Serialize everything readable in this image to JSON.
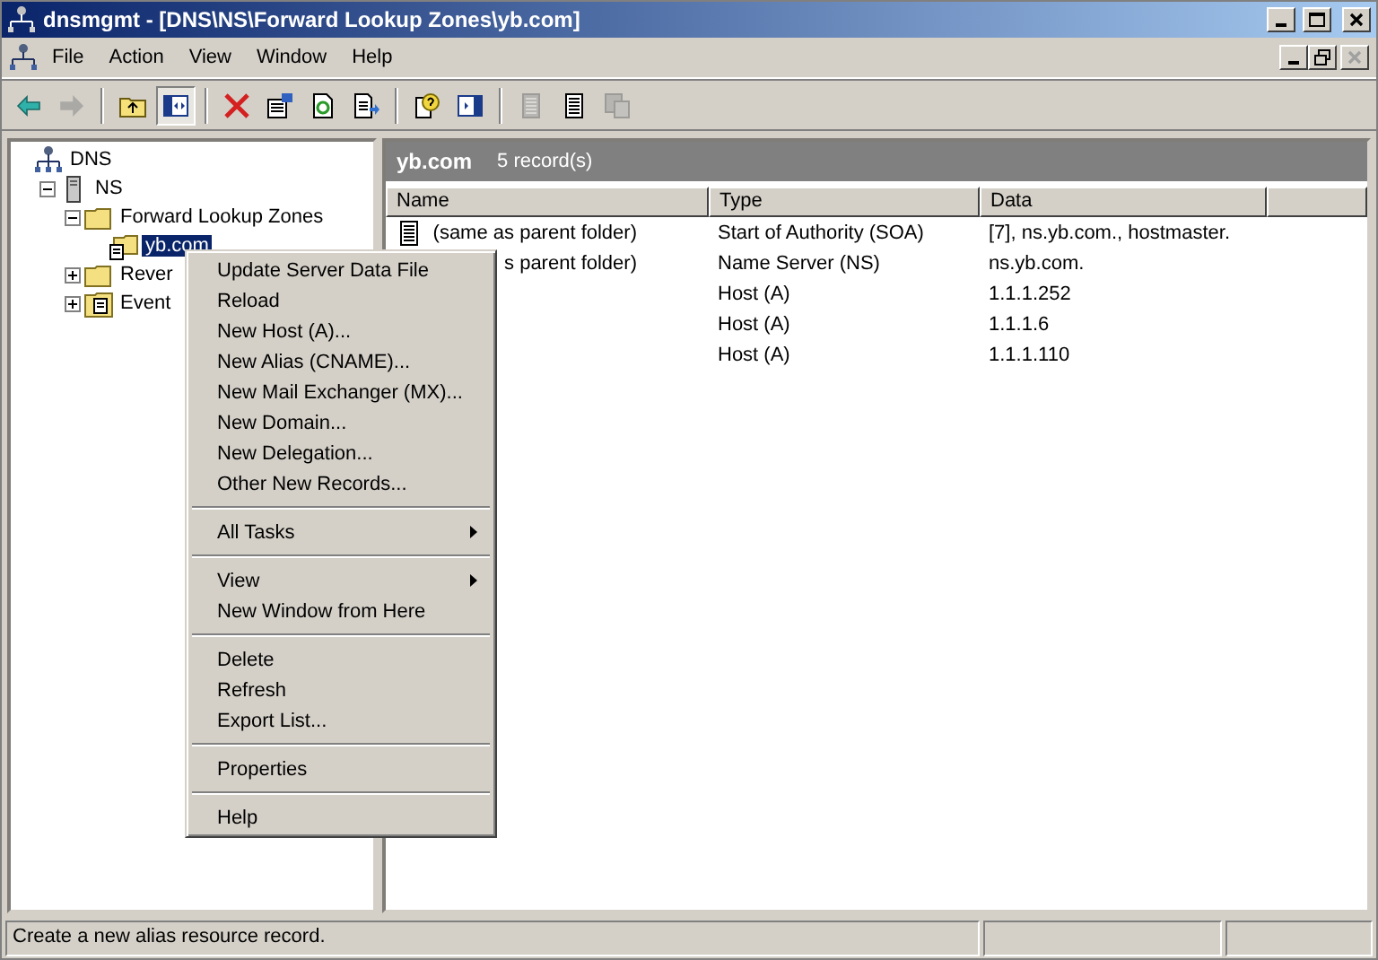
{
  "window": {
    "title": "dnsmgmt - [DNS\\NS\\Forward Lookup Zones\\yb.com]"
  },
  "menu_bar": [
    "File",
    "Action",
    "View",
    "Window",
    "Help"
  ],
  "toolbar": [
    {
      "kind": "back",
      "disabled": false
    },
    {
      "kind": "forward",
      "disabled": true
    },
    {
      "kind": "sep"
    },
    {
      "kind": "up",
      "disabled": false
    },
    {
      "kind": "tree",
      "disabled": false,
      "pressed": true
    },
    {
      "kind": "sep"
    },
    {
      "kind": "delete",
      "disabled": false
    },
    {
      "kind": "properties",
      "disabled": false
    },
    {
      "kind": "refresh",
      "disabled": false
    },
    {
      "kind": "export",
      "disabled": false
    },
    {
      "kind": "sep"
    },
    {
      "kind": "help",
      "disabled": false
    },
    {
      "kind": "pane",
      "disabled": false
    },
    {
      "kind": "sep"
    },
    {
      "kind": "doc",
      "disabled": true
    },
    {
      "kind": "doc",
      "disabled": false
    },
    {
      "kind": "copy",
      "disabled": true
    }
  ],
  "tree": [
    {
      "label": "DNS",
      "kind": "root",
      "selected": false,
      "children": [
        {
          "label": "NS",
          "kind": "server",
          "expanded": true,
          "selected": false,
          "children": [
            {
              "label": "Forward Lookup Zones",
              "kind": "folder",
              "expanded": true,
              "selected": false,
              "children": [
                {
                  "label": "yb.com",
                  "kind": "zone",
                  "selected": true
                }
              ]
            },
            {
              "label": "Rever",
              "kind": "folder",
              "expanded": false,
              "selected": false
            },
            {
              "label": "Event",
              "kind": "log",
              "expanded": false,
              "selected": false
            }
          ]
        }
      ]
    }
  ],
  "details": {
    "title": "yb.com",
    "count": "5 record(s)",
    "columns": [
      "Name",
      "Type",
      "Data"
    ],
    "rows": [
      {
        "name": "(same as parent folder)",
        "icon": true,
        "type": "Start of Authority (SOA)",
        "data": "[7], ns.yb.com., hostmaster."
      },
      {
        "name": "s parent folder)",
        "type": "Name Server (NS)",
        "data": "ns.yb.com."
      },
      {
        "type": "Host (A)",
        "data": "1.1.1.252"
      },
      {
        "type": "Host (A)",
        "data": "1.1.1.6"
      },
      {
        "type": "Host (A)",
        "data": "1.1.1.110"
      }
    ]
  },
  "context_menu": [
    [
      {
        "label": "Update Server Data File",
        "submenu": false
      },
      {
        "label": "Reload",
        "submenu": false
      },
      {
        "label": "New Host (A)...",
        "submenu": false
      },
      {
        "label": "New Alias (CNAME)...",
        "submenu": false
      },
      {
        "label": "New Mail Exchanger (MX)...",
        "submenu": false
      },
      {
        "label": "New Domain...",
        "submenu": false
      },
      {
        "label": "New Delegation...",
        "submenu": false
      },
      {
        "label": "Other New Records...",
        "submenu": false
      }
    ],
    [
      {
        "label": "All Tasks",
        "submenu": true
      }
    ],
    [
      {
        "label": "View",
        "submenu": true
      },
      {
        "label": "New Window from Here",
        "submenu": false
      }
    ],
    [
      {
        "label": "Delete",
        "submenu": false
      },
      {
        "label": "Refresh",
        "submenu": false
      },
      {
        "label": "Export List...",
        "submenu": false
      }
    ],
    [
      {
        "label": "Properties",
        "submenu": false
      }
    ],
    [
      {
        "label": "Help",
        "submenu": false
      }
    ]
  ],
  "status_bar": {
    "text": "Create a new alias resource record."
  }
}
